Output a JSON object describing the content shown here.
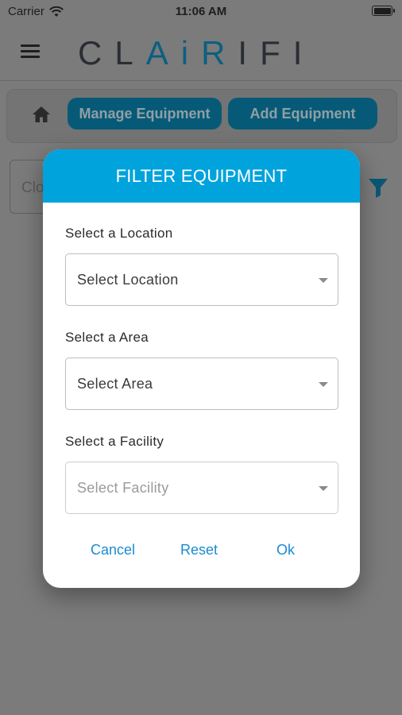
{
  "status_bar": {
    "carrier": "Carrier",
    "time": "11:06 AM"
  },
  "header": {
    "logo_text": "CLAiRIFI"
  },
  "nav": {
    "manage_label": "Manage Equipment",
    "add_label": "Add Equipment"
  },
  "search": {
    "partial_text": "Clo"
  },
  "modal": {
    "title": "FILTER EQUIPMENT",
    "location": {
      "label": "Select a Location",
      "placeholder": "Select Location"
    },
    "area": {
      "label": "Select a Area",
      "placeholder": "Select Area"
    },
    "facility": {
      "label": "Select a Facility",
      "placeholder": "Select Facility"
    },
    "actions": {
      "cancel": "Cancel",
      "reset": "Reset",
      "ok": "Ok"
    }
  },
  "colors": {
    "modal_header": "#00a3dc",
    "action_text": "#1a8bd2",
    "nav_button": "#075a77"
  }
}
